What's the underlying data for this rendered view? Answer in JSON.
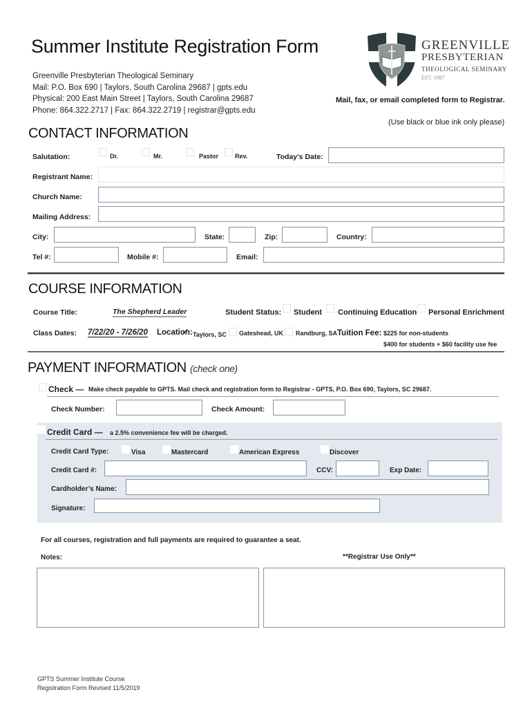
{
  "header": {
    "title": "Summer Institute Registration Form",
    "address_lines": [
      "Greenville Presbyterian Theological Seminary",
      "Mail: P.O. Box 690 | Taylors, South Carolina 29687 | gpts.edu",
      "Physical: 200 East Main Street | Taylors, South Carolina 29687",
      "Phone: 864.322.2717 | Fax: 864.322.2719 | registrar@gpts.edu"
    ],
    "logo": {
      "line1": "GREENVILLE",
      "line2": "PRESBYTERIAN",
      "line3": "THEOLOGICAL SEMINARY",
      "line4": "EST. 1987",
      "icon": "shield-crest-icon"
    },
    "mail_note": "Mail, fax, or email completed form to Registrar.",
    "ink_note": "(Use black or blue ink only please)"
  },
  "contact": {
    "title": "CONTACT INFORMATION",
    "salutation_label": "Salutation:",
    "salutations": [
      "Dr.",
      "Mr.",
      "Pastor",
      "Rev."
    ],
    "todays_date_label": "Today’s Date:",
    "todays_date_value": "",
    "registrant_name_label": "Registrant Name:",
    "church_name_label": "Church Name:",
    "mailing_address_label": "Mailing Address:",
    "city_label": "City:",
    "state_label": "State:",
    "zip_label": "Zip:",
    "country_label": "Country:",
    "tel_label": "Tel #:",
    "mobile_label": "Mobile #:",
    "email_label": "Email:"
  },
  "course": {
    "title": "COURSE INFORMATION",
    "course_title_label": "Course Title:",
    "course_title_value": "The Shepherd Leader",
    "student_status_label": "Student Status:",
    "student_statuses": [
      "Student",
      "Continuing Education",
      "Personal Enrichment"
    ],
    "class_dates_label": "Class Dates:",
    "class_dates_value": "7/22/20 - 7/26/20",
    "location_label": "Location:",
    "locations": [
      {
        "label": "Taylors, SC",
        "checked": true
      },
      {
        "label": "Gateshead, UK",
        "checked": false
      },
      {
        "label": "Randburg, SA",
        "checked": false
      }
    ],
    "tuition_label": "Tuition Fee:",
    "tuition_lines": [
      "$225 for non-students",
      "$400 for students + $60 facility use fee"
    ]
  },
  "payment": {
    "title": "PAYMENT INFORMATION",
    "title_note": "(check one)",
    "check_label": "Check —",
    "check_note": "Make check payable to GPTS. Mail check and registration form to Registrar - GPTS, P.O. Box 690, Taylors, SC 29687.",
    "check_number_label": "Check Number:",
    "check_amount_label": "Check Amount:",
    "credit_label": "Credit Card —",
    "credit_note": "a 2.5% convenience fee will be charged.",
    "card_type_label": "Credit Card Type:",
    "card_types": [
      "Visa",
      "Mastercard",
      "American Express",
      "Discover"
    ],
    "card_number_label": "Credit Card #:",
    "ccv_label": "CCV:",
    "exp_label": "Exp Date:",
    "cardholder_label": "Cardholder’s Name:",
    "signature_label": "Signature:",
    "panel_color": "#e4e8ef"
  },
  "notes": {
    "policy": "For all courses, registration and full payments are required to guarantee a seat.",
    "notes_label": "Notes:",
    "registrar_label": "**Registrar Use Only**"
  },
  "footer": {
    "line1": "GPTS Summer Institute Course",
    "line2": "Registration Form Revised 11/5/2019"
  }
}
